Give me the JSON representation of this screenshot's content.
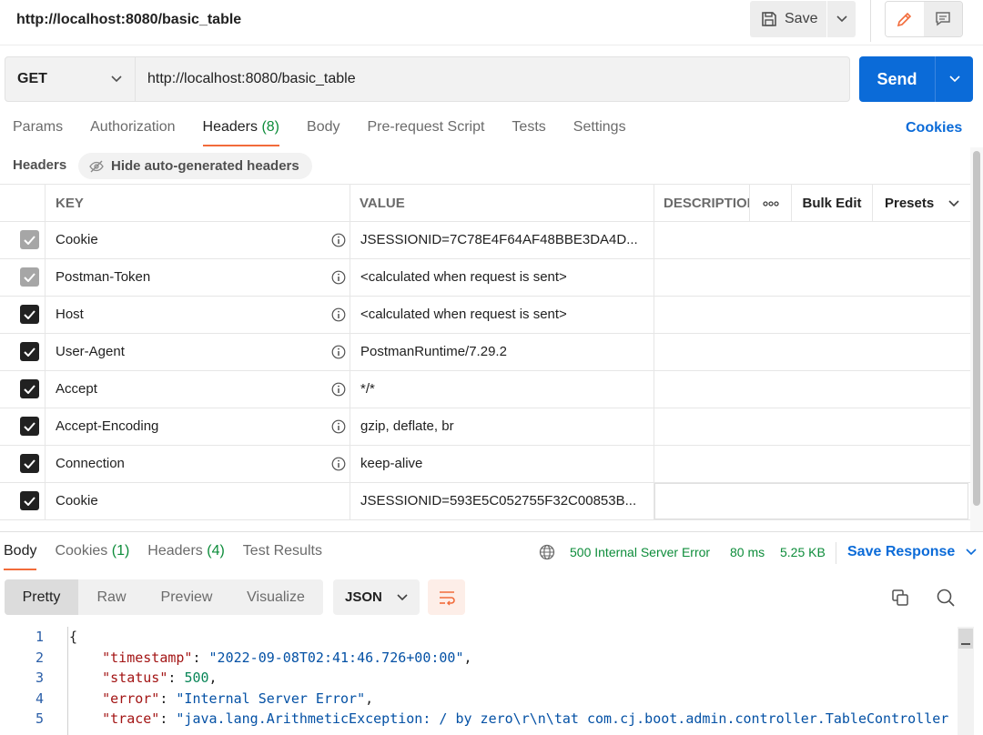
{
  "header": {
    "title": "http://localhost:8080/basic_table",
    "save_label": "Save"
  },
  "request": {
    "method": "GET",
    "url": "http://localhost:8080/basic_table",
    "send_label": "Send"
  },
  "request_tabs": [
    {
      "label": "Params",
      "count": ""
    },
    {
      "label": "Authorization",
      "count": ""
    },
    {
      "label": "Headers",
      "count": "(8)"
    },
    {
      "label": "Body",
      "count": ""
    },
    {
      "label": "Pre-request Script",
      "count": ""
    },
    {
      "label": "Tests",
      "count": ""
    },
    {
      "label": "Settings",
      "count": ""
    }
  ],
  "cookies_link": "Cookies",
  "headers_section": {
    "label": "Headers",
    "hide_auto_label": "Hide auto-generated headers"
  },
  "table": {
    "columns": {
      "key": "KEY",
      "value": "VALUE",
      "description": "DESCRIPTION"
    },
    "bulk_edit": "Bulk Edit",
    "presets": "Presets",
    "rows": [
      {
        "key": "Cookie",
        "value": "JSESSIONID=7C78E4F64AF48BBE3DA4D...",
        "auto": true
      },
      {
        "key": "Postman-Token",
        "value": "<calculated when request is sent>",
        "auto": true
      },
      {
        "key": "Host",
        "value": "<calculated when request is sent>",
        "auto": false
      },
      {
        "key": "User-Agent",
        "value": "PostmanRuntime/7.29.2",
        "auto": false
      },
      {
        "key": "Accept",
        "value": "*/*",
        "auto": false
      },
      {
        "key": "Accept-Encoding",
        "value": "gzip, deflate, br",
        "auto": false
      },
      {
        "key": "Connection",
        "value": "keep-alive",
        "auto": false
      },
      {
        "key": "Cookie",
        "value": "JSESSIONID=593E5C052755F32C00853B...",
        "auto": false
      }
    ]
  },
  "response_tabs": [
    {
      "label": "Body",
      "count": ""
    },
    {
      "label": "Cookies",
      "count": "(1)"
    },
    {
      "label": "Headers",
      "count": "(4)"
    },
    {
      "label": "Test Results",
      "count": ""
    }
  ],
  "response_meta": {
    "status": "500 Internal Server Error",
    "time": "80 ms",
    "size": "5.25 KB",
    "save_response": "Save Response"
  },
  "view_modes": [
    "Pretty",
    "Raw",
    "Preview",
    "Visualize"
  ],
  "format": "JSON",
  "code_lines": [
    {
      "n": "1",
      "key": "",
      "value": "",
      "text": "{"
    },
    {
      "n": "2",
      "key": "\"timestamp\"",
      "value": "\"2022-09-08T02:41:46.726+00:00\"",
      "text": ""
    },
    {
      "n": "3",
      "key": "\"status\"",
      "value": "500",
      "text": ""
    },
    {
      "n": "4",
      "key": "\"error\"",
      "value": "\"Internal Server Error\"",
      "text": ""
    },
    {
      "n": "5",
      "key": "\"trace\"",
      "value": "\"java.lang.ArithmeticException: / by zero\\r\\n\\tat com.cj.boot.admin.controller.TableController",
      "text": ""
    }
  ],
  "colors": {
    "accent": "#f26b3a",
    "primary": "#0b6bd8",
    "success": "#0d8c3a"
  }
}
